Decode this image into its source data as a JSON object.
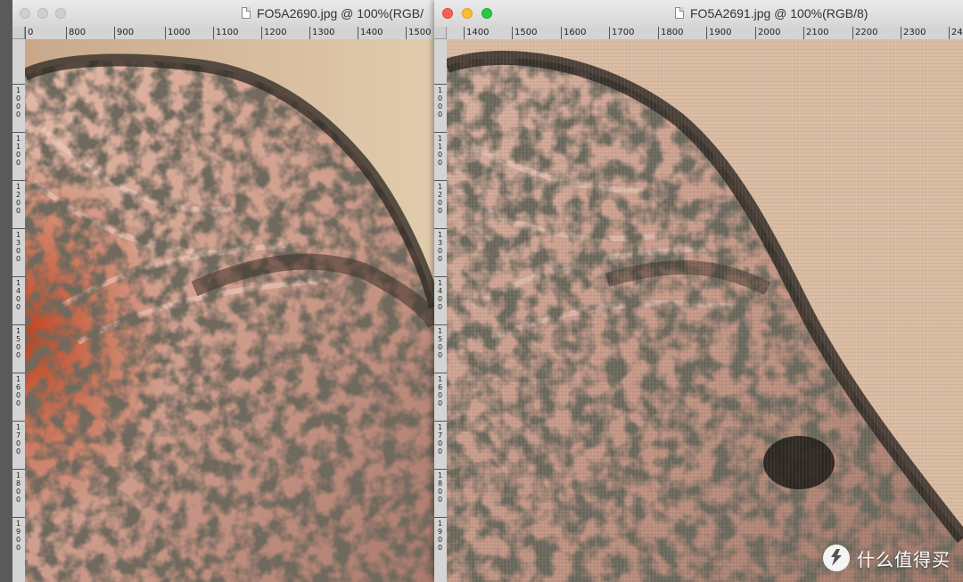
{
  "windows": [
    {
      "title": "FO5A2690.jpg @ 100%(RGB/",
      "active": false,
      "ruler_labels": [
        "0",
        "800",
        "900",
        "1000",
        "1100",
        "1200",
        "1300",
        "1400",
        "1500"
      ],
      "vruler_labels": [
        "1000",
        "1100",
        "1200",
        "1300",
        "1400",
        "1500",
        "1600",
        "1700",
        "1800",
        "1900"
      ]
    },
    {
      "title": "FO5A2691.jpg @ 100%(RGB/8)",
      "active": true,
      "ruler_labels": [
        "1400",
        "1500",
        "1600",
        "1700",
        "1800",
        "1900",
        "2000",
        "2100",
        "2200",
        "2300",
        "24"
      ],
      "vruler_labels": [
        "1000",
        "1100",
        "1200",
        "1300",
        "1400",
        "1500",
        "1600",
        "1700",
        "1800",
        "1900"
      ]
    }
  ],
  "watermark": {
    "logo_icon": "smzdm-logo-icon",
    "text": "什么值得买"
  },
  "colors": {
    "close": "#fd5f57",
    "minimize": "#fdbc2e",
    "zoom": "#28c840",
    "inactive_light": "#d0d0d0",
    "skin": "#d6a89a",
    "background_left": "#dcc3a5",
    "background_right": "#d9bba2",
    "dirt": "#2a2620",
    "orange": "#c55a2c"
  }
}
